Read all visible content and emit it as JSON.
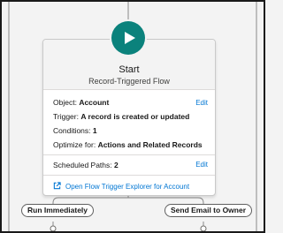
{
  "start_element": {
    "icon": "play-icon",
    "accent_color": "#0b827c",
    "title": "Start",
    "subtitle": "Record-Triggered Flow"
  },
  "details": {
    "object_label": "Object:",
    "object_value": "Account",
    "trigger_label": "Trigger:",
    "trigger_value": "A record is created or updated",
    "conditions_label": "Conditions:",
    "conditions_value": "1",
    "optimize_label": "Optimize for:",
    "optimize_value": "Actions and Related Records",
    "edit_label": "Edit"
  },
  "scheduled": {
    "label": "Scheduled Paths:",
    "value": "2",
    "edit_label": "Edit"
  },
  "explorer_link": {
    "icon": "open-external-icon",
    "label": "Open Flow Trigger Explorer for Account"
  },
  "paths": [
    {
      "label": "Run Immediately"
    },
    {
      "label": "Send Email to Owner"
    }
  ]
}
